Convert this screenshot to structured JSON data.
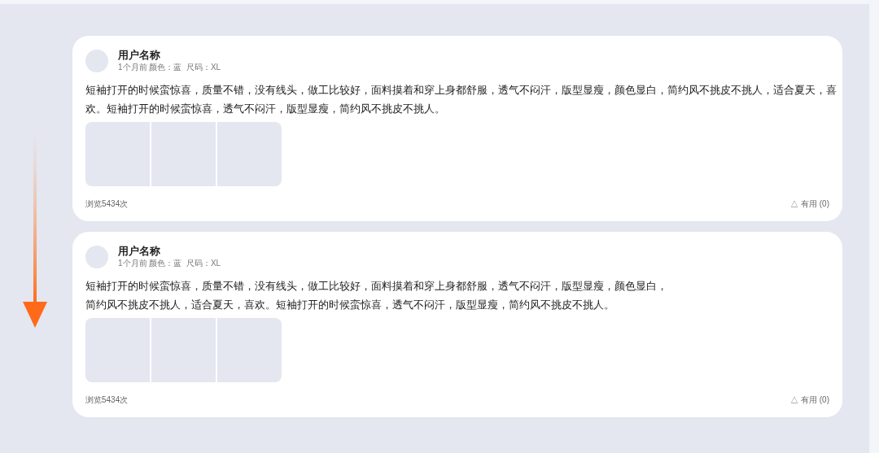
{
  "reviews": [
    {
      "username": "用户名称",
      "meta": "1个月前 颜色：蓝  尺码：XL",
      "text_lines": [
        "短袖打开的时候蛮惊喜，质量不错，没有线头，做工比较好，面料摸着和穿上身都舒服，透气不闷汗，版型显瘦，颜色显白，简约风不挑皮不挑人，适合夏天，喜",
        "欢。短袖打开的时候蛮惊喜，透气不闷汗，版型显瘦，简约风不挑皮不挑人。"
      ],
      "views": "浏览5434次",
      "helpful": "△ 有用 (0)"
    },
    {
      "username": "用户名称",
      "meta": "1个月前 颜色：蓝  尺码：XL",
      "text_lines": [
        "短袖打开的时候蛮惊喜，质量不错，没有线头，做工比较好，面料摸着和穿上身都舒服，透气不闷汗，版型显瘦，颜色显白，",
        "简约风不挑皮不挑人，适合夏天，喜欢。短袖打开的时候蛮惊喜，透气不闷汗，版型显瘦，简约风不挑皮不挑人。"
      ],
      "views": "浏览5434次",
      "helpful": "△ 有用 (0)"
    }
  ]
}
